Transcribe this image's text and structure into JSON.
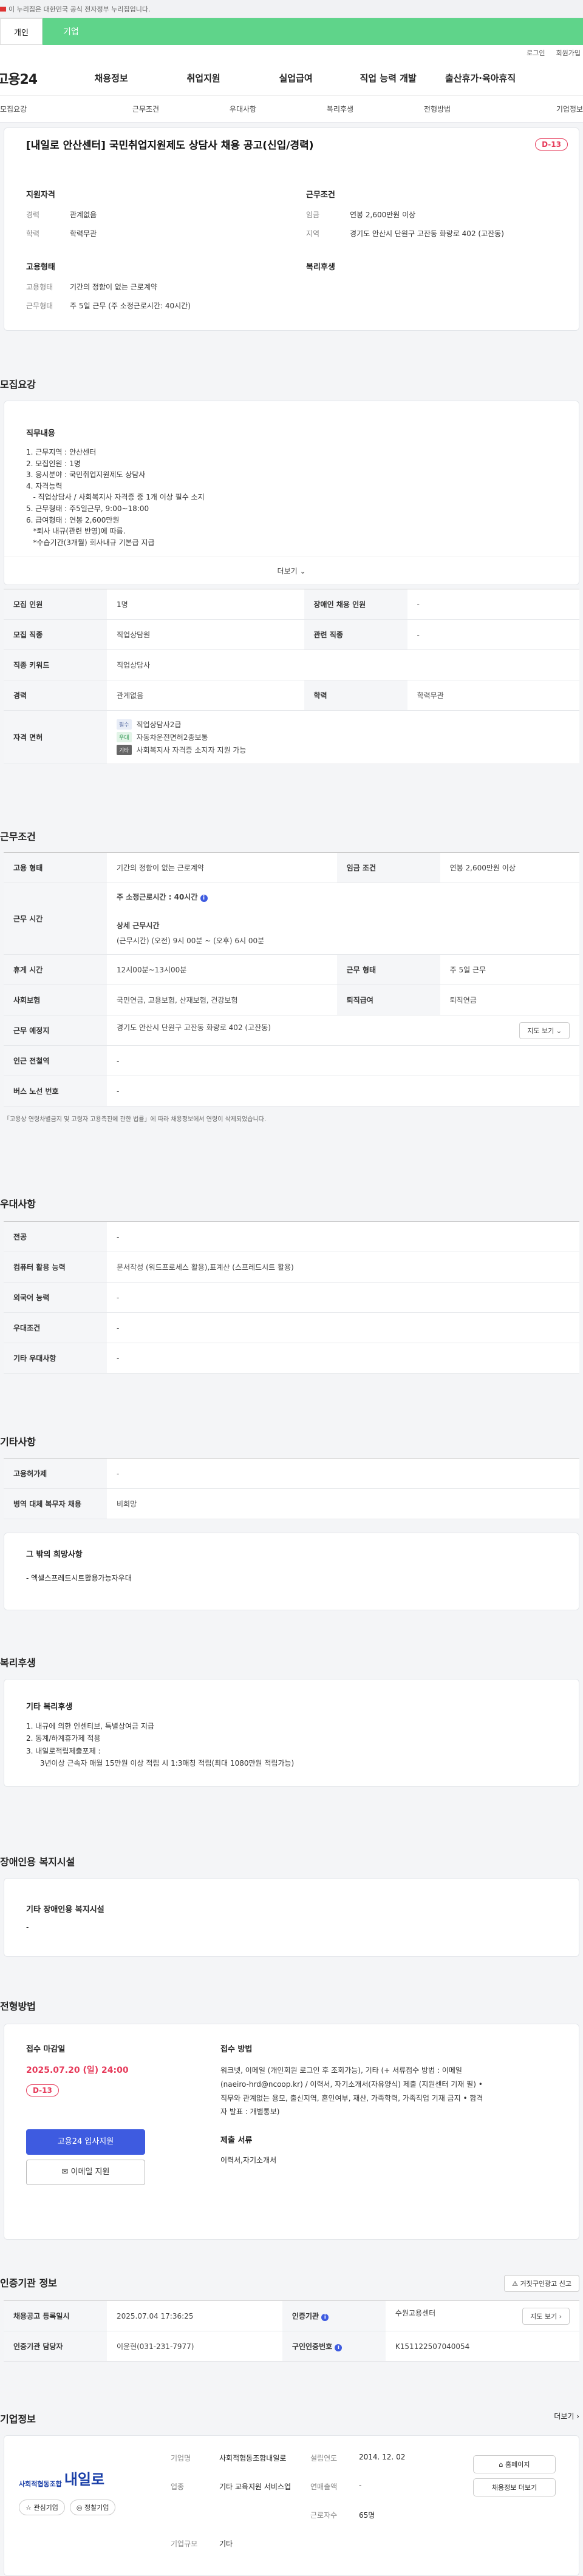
{
  "gov_strip": "이 누리집은 대한민국 공식 전자정부 누리집입니다.",
  "top_tabs": {
    "personal": "개인",
    "company": "기업"
  },
  "util": {
    "login": "로그인",
    "signup": "회원가입"
  },
  "logo": "고용24",
  "gnb": [
    "채용정보",
    "취업지원",
    "실업급여",
    "직업 능력 개발",
    "출산휴가·육아휴직"
  ],
  "subnav": [
    "모집요강",
    "근무조건",
    "우대사항",
    "복리후생",
    "전형방법",
    "기업정보"
  ],
  "job": {
    "title": "[내일로 안산센터] 국민취업지원제도 상담사 채용 공고(신입/경력)",
    "dday": "D-13",
    "qual_title": "지원자격",
    "cond_title": "근무조건",
    "emp_title": "고용형태",
    "welfare_title": "복리후생",
    "qual": [
      {
        "k": "경력",
        "v": "관계없음"
      },
      {
        "k": "학력",
        "v": "학력무관"
      }
    ],
    "cond": [
      {
        "k": "임금",
        "v": "연봉 2,600만원 이상"
      },
      {
        "k": "지역",
        "v": "경기도 안산시 단원구 고잔동 화랑로 402 (고잔동)"
      }
    ],
    "emp": [
      {
        "k": "고용형태",
        "v": "기간의 정함이 없는 근로계약"
      },
      {
        "k": "근무형태",
        "v": "주 5일 근무 (주 소정근로시간: 40시간)"
      }
    ]
  },
  "recruit": {
    "title": "모집요강",
    "duty_title": "직무내용",
    "duty_lines": [
      "1. 근무지역 : 안산센터",
      "2. 모집인원 : 1명",
      "3. 응시분야 : 국민취업지원제도 상담사",
      "4. 자격능력",
      "   - 직업상담사 / 사회복지사 자격증 중 1개 이상 필수 소지",
      "5. 근무형태 : 주5일근무, 9:00~18:00",
      "6. 급여형태 : 연봉 2,600만원",
      "   *퇴사 내규(관련 반영)에 따름.",
      "   *수습기간(3개월) 회사내규 기본급 지급"
    ],
    "more": "더보기",
    "rows": [
      {
        "k": "모집 인원",
        "v": "1명",
        "k2": "장애인 채용 인원",
        "v2": "-"
      },
      {
        "k": "모집 직종",
        "v": "직업상담원",
        "k2": "관련 직종",
        "v2": "-"
      },
      {
        "k": "직종 키워드",
        "v": "직업상담사"
      },
      {
        "k": "경력",
        "v": "관계없음",
        "k2": "학력",
        "v2": "학력무관"
      }
    ],
    "license_label": "자격 면허",
    "licenses": [
      {
        "tag": "필수",
        "name": "직업상담사2급",
        "color": "#e8edf7",
        "tcolor": "#5a6fa5"
      },
      {
        "tag": "우대",
        "name": "자동차운전면허2종보통",
        "color": "#e2f4e7",
        "tcolor": "#2f9650"
      },
      {
        "tag": "기타",
        "name": "사회복지사 자격증 소지자 지원 가능",
        "color": "#666666",
        "tcolor": "#ffffff"
      }
    ]
  },
  "work": {
    "title": "근무조건",
    "emp_k": "고용 형태",
    "emp_v": "기간의 정함이 없는 근로계약",
    "wage_k": "임금 조건",
    "wage_v": "연봉 2,600만원 이상",
    "time_k": "근무 시간",
    "time_main": "주 소정근로시간 : 40시간",
    "time_detail_title": "상세 근무시간",
    "time_detail": "(근무시간) (오전) 9시 00분 ~ (오후) 6시 00분",
    "rest_k": "휴게 시간",
    "rest_v": "12시00분~13시00분",
    "form_k": "근무 형태",
    "form_v": "주 5일 근무",
    "ins_k": "사회보험",
    "ins_v": "국민연금, 고용보험, 산재보험, 건강보험",
    "ret_k": "퇴직급여",
    "ret_v": "퇴직연금",
    "place_k": "근무 예정지",
    "place_v": "경기도 안산시 단원구 고잔동 화랑로 402 (고잔동)",
    "map": "지도 보기",
    "metro_k": "인근 전철역",
    "metro_v": "-",
    "bus_k": "버스 노선 번호",
    "bus_v": "-",
    "note": "「고용상 연령차별금지 및 고령자 고용촉진에 관한 법률」에 따라 채용정보에서 연령이 삭제되었습니다."
  },
  "pref": {
    "title": "우대사항",
    "rows": [
      {
        "k": "전공",
        "v": "-"
      },
      {
        "k": "컴퓨터 활용 능력",
        "v": "문서작성 (워드프로세스 활용),표계산 (스프레드시트 활용)"
      },
      {
        "k": "외국어 능력",
        "v": "-"
      },
      {
        "k": "우대조건",
        "v": "-"
      },
      {
        "k": "기타 우대사항",
        "v": "-"
      }
    ]
  },
  "etc": {
    "title": "기타사항",
    "rows": [
      {
        "k": "고용허가제",
        "v": "-"
      },
      {
        "k": "병역 대체 복무자 채용",
        "v": "비희망"
      }
    ],
    "wish_title": "그 밖의 희망사항",
    "wish": "- 엑셀스프레드시트활용가능자우대"
  },
  "welfare": {
    "title": "복리후생",
    "box_title": "기타 복리후생",
    "lines": [
      "1. 내규에 의한 인센티브, 특별상여금 지급",
      "2. 동계/하계휴가제 적용",
      "3. 내일로적립제출포제 :",
      "      3년이상 근속자 매월 15만원 이상 적립 시 1:3매칭 적립(최대 1080만원 적립가능)"
    ]
  },
  "disabled": {
    "title": "장애인용 복지시설",
    "box_title": "기타 장애인용 복지시설",
    "v": "-"
  },
  "apply": {
    "title": "전형방법",
    "deadline_title": "접수 마감일",
    "deadline": "2025.07.20 (일) 24:00",
    "dday": "D-13",
    "apply_btn": "고용24 입사지원",
    "email_btn": "이메일 지원",
    "method_title": "접수 방법",
    "method": "워크넷, 이메일 (개인회원 로그인 후 조회가능), 기타 (+ 서류접수 방법 : 이메일(naeiro-hrd@ncoop.kr) / 이력서, 자기소개서(자유양식) 제출 (지원센터 기재 필)    • 직무와 관계없는 용모, 출신지역, 혼인여부, 재산, 가족학력, 가족직업 기재 금지 • 합격자 발표 : 개별통보)",
    "docs_title": "제출 서류",
    "docs": "이력서,자기소개서"
  },
  "cert": {
    "title": "인증기관 정보",
    "report_btn": "거짓구인광고 신고",
    "reg_k": "채용공고 등록일시",
    "reg_v": "2025.07.04 17:36:25",
    "org_k": "인증기관",
    "org_v": "수원고용센터",
    "map": "지도 보기",
    "mgr_k": "인증기관 담당자",
    "mgr_v": "이윤현(031-231-7977)",
    "no_k": "구인인증번호",
    "no_v": "K151122507040054"
  },
  "company": {
    "title": "기업정보",
    "more": "더보기",
    "logo_small": "사회적협동조합",
    "logo_big": "내일로",
    "fav": "관심기업",
    "review": "정찰기업",
    "rows": [
      {
        "k": "기업명",
        "v": "사회적협동조합내일로",
        "k2": "설립연도",
        "v2": "2014. 12. 02"
      },
      {
        "k": "업종",
        "v": "기타 교육지원 서비스업",
        "k2": "연매출액",
        "v2": "-"
      },
      {
        "k": "",
        "v": "",
        "k2": "근로자수",
        "v2": "65명"
      },
      {
        "k": "기업규모",
        "v": "기타",
        "k2": "",
        "v2": ""
      }
    ],
    "home_btn": "홈페이지",
    "list_btn": "채용정보 더보기"
  }
}
